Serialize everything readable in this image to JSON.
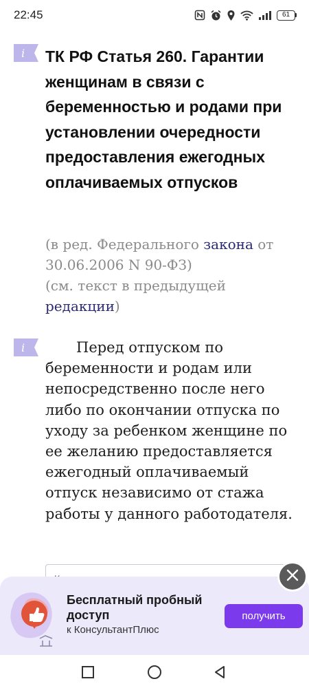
{
  "status_bar": {
    "time": "22:45",
    "battery": "61",
    "icons": [
      "nfc-icon",
      "alarm-icon",
      "location-icon",
      "wifi-icon",
      "signal-icon",
      "battery-icon"
    ]
  },
  "article": {
    "title": "ТК РФ Статья 260. Гарантии женщинам в связи с беременностью и родами при установлении очередности предоставления ежегодных оплачиваемых отпусков",
    "edition": {
      "part1": "(в ред. Федерального ",
      "link1": "закона",
      "part2": " от 30.06.2006 N 90-ФЗ)",
      "part3": "(см. текст в предыдущей ",
      "link2": "редакции",
      "part4": ")"
    },
    "body": "Перед отпуском по беременности и родам или непосредственно после него либо по окончании отпуска по уходу за ребенком женщине по ее желанию предоставляется ежегодный оплачиваемый отпуск независимо от стажа работы у данного работодателя.",
    "hint_card_text": "Как перед декретом предоставить отпуск"
  },
  "promo": {
    "title": "Бесплатный пробный доступ",
    "subtitle": "к КонсультантПлюс",
    "button_label": "получить"
  },
  "colors": {
    "accent": "#7c3aed",
    "link": "#2a2a73",
    "marker": "#bcb6ea",
    "promo_bg": "#ece9fb"
  }
}
